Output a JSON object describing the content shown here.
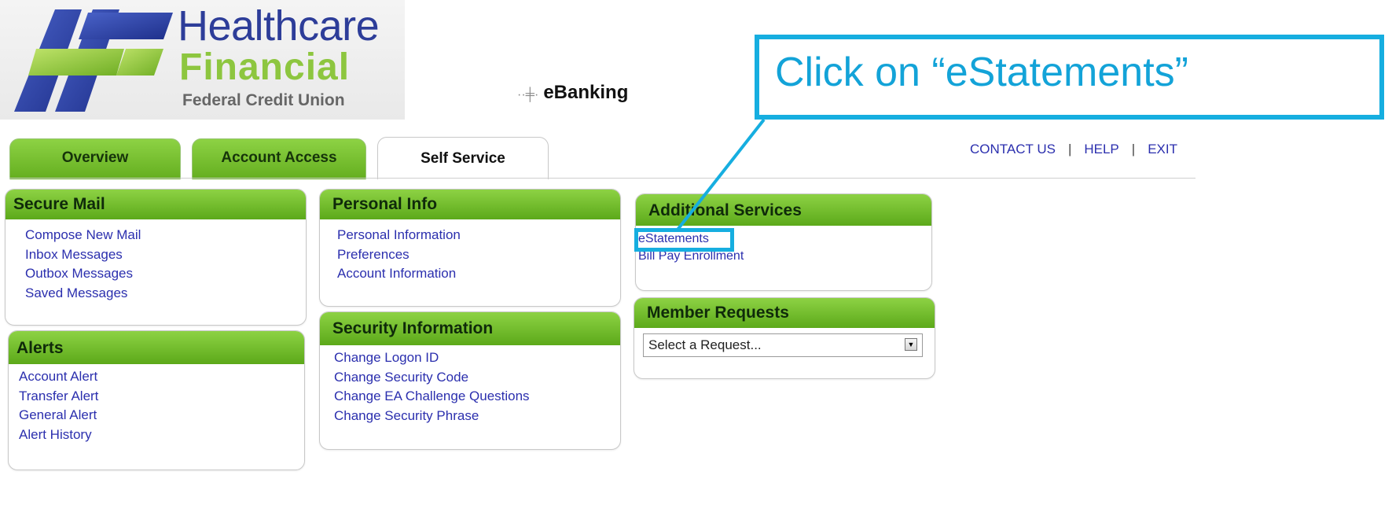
{
  "logo": {
    "line1": "Healthcare",
    "line2": "Financial",
    "line3": "Federal Credit Union",
    "icon": "hf-logo-icon"
  },
  "app_name": "eBanking",
  "callout": {
    "text": "Click on “eStatements”",
    "color": "#16aee0"
  },
  "top_links": [
    "CONTACT US",
    "HELP",
    "EXIT"
  ],
  "tabs": [
    {
      "label": "Overview",
      "active": false
    },
    {
      "label": "Account Access",
      "active": false
    },
    {
      "label": "Self Service",
      "active": true
    }
  ],
  "panels": {
    "secure_mail": {
      "title": "Secure Mail",
      "items": [
        "Compose New Mail",
        "Inbox Messages",
        "Outbox Messages",
        "Saved Messages"
      ]
    },
    "alerts": {
      "title": "Alerts",
      "items": [
        "Account Alert",
        "Transfer Alert",
        "General Alert",
        "Alert History"
      ]
    },
    "personal_info": {
      "title": "Personal Info",
      "items": [
        "Personal Information",
        "Preferences",
        "Account Information"
      ]
    },
    "security_info": {
      "title": "Security Information",
      "items": [
        "Change Logon ID",
        "Change Security Code",
        "Change EA Challenge Questions",
        "Change Security Phrase"
      ]
    },
    "additional_services": {
      "title": "Additional Services",
      "items": [
        "eStatements",
        "Bill Pay Enrollment"
      ]
    },
    "member_requests": {
      "title": "Member Requests",
      "select_value": "Select a Request..."
    }
  },
  "colors": {
    "tab_green": "#6cb52a",
    "link_blue": "#2b2fae",
    "highlight_blue": "#16aee0"
  }
}
